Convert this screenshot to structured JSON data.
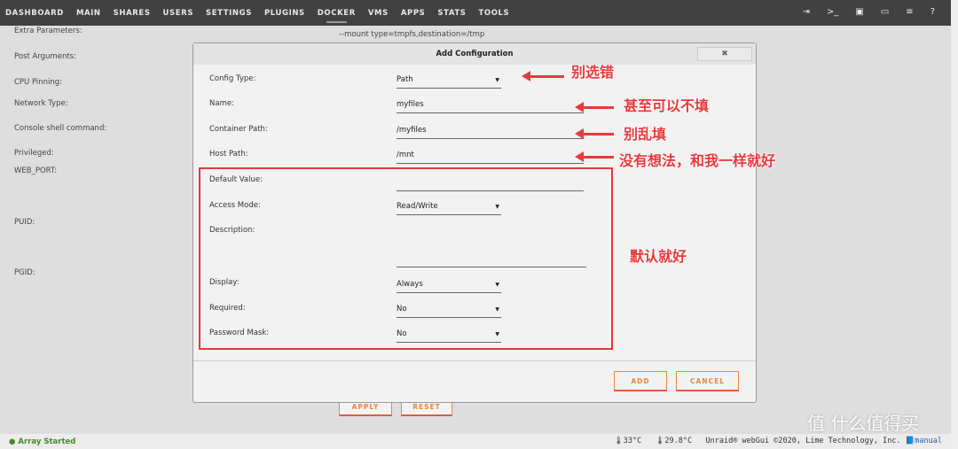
{
  "nav": {
    "items": [
      "DASHBOARD",
      "MAIN",
      "SHARES",
      "USERS",
      "SETTINGS",
      "PLUGINS",
      "DOCKER",
      "VMS",
      "APPS",
      "STATS",
      "TOOLS"
    ],
    "active": "DOCKER",
    "icons": [
      "logout-icon",
      "terminal-icon",
      "feedback-icon",
      "display-icon",
      "log-icon",
      "help-icon"
    ]
  },
  "background": {
    "labels": [
      "Extra Parameters:",
      "Post Arguments:",
      "CPU Pinning:",
      "Network Type:",
      "Console shell command:",
      "Privileged:",
      "WEB_PORT:",
      "PUID:",
      "PGID:"
    ],
    "extra_params_value": "--mount type=tmpfs,destination=/tmp",
    "apply": "APPLY",
    "reset": "RESET"
  },
  "modal": {
    "title": "Add Configuration",
    "close": "✖",
    "fields": [
      {
        "label": "Config Type:",
        "value": "Path",
        "type": "select"
      },
      {
        "label": "Name:",
        "value": "myfiles",
        "type": "text"
      },
      {
        "label": "Container Path:",
        "value": "/myfiles",
        "type": "text"
      },
      {
        "label": "Host Path:",
        "value": "/mnt",
        "type": "text"
      },
      {
        "label": "Default Value:",
        "value": "",
        "type": "text"
      },
      {
        "label": "Access Mode:",
        "value": "Read/Write",
        "type": "select"
      },
      {
        "label": "Description:",
        "value": "",
        "type": "textarea"
      },
      {
        "label": "Display:",
        "value": "Always",
        "type": "select"
      },
      {
        "label": "Required:",
        "value": "No",
        "type": "select"
      },
      {
        "label": "Password Mask:",
        "value": "No",
        "type": "select"
      }
    ],
    "add": "ADD",
    "cancel": "CANCEL"
  },
  "annotations": {
    "a1": "别选错",
    "a2": "甚至可以不填",
    "a3": "别乱填",
    "a4": "没有想法，和我一样就好",
    "a5": "默认就好",
    "color": "#e8393c"
  },
  "footer": {
    "status": "Array Started",
    "temp1": "33°C",
    "temp2": "29.8°C",
    "copyright": "Unraid® webGui ©2020, Lime Technology, Inc.",
    "manual": "manual"
  },
  "watermark": "值 什么值得买"
}
